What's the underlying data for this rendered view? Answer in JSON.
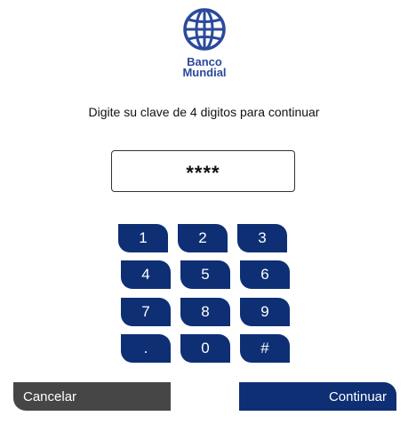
{
  "brand": {
    "line1": "Banco",
    "line2": "Mundial",
    "color": "#2b4a9b"
  },
  "prompt": "Digite su clave de 4 digitos para continuar",
  "pin": {
    "value": "****"
  },
  "keypad": {
    "color": "#0e2f74",
    "keys": [
      "1",
      "2",
      "3",
      "4",
      "5",
      "6",
      "7",
      "8",
      "9",
      ".",
      "0",
      "#"
    ]
  },
  "actions": {
    "cancel_label": "Cancelar",
    "continue_label": "Continuar",
    "cancel_color": "#464646",
    "continue_color": "#0e2f74"
  }
}
